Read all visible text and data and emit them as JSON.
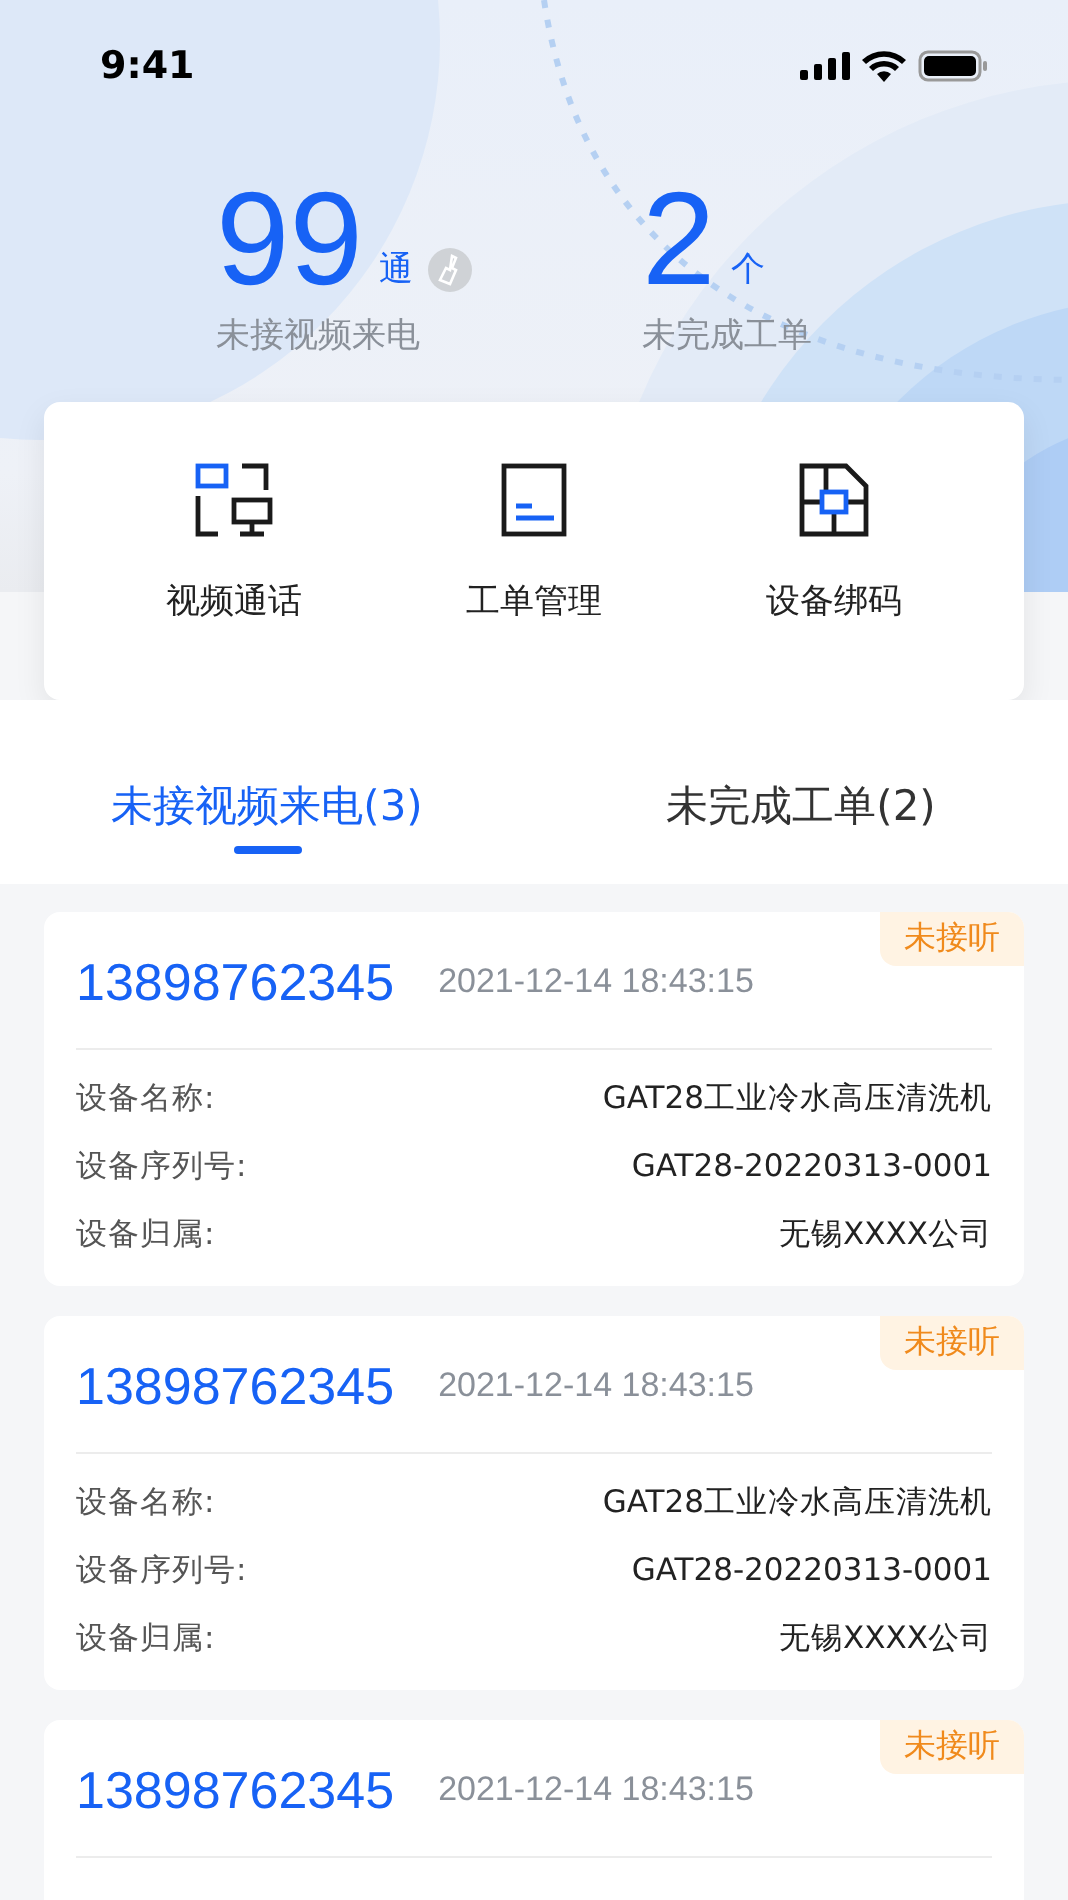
{
  "status_bar": {
    "time": "9:41"
  },
  "stats": [
    {
      "value": "99",
      "unit": "通",
      "label": "未接视频来电",
      "kind": "clearable"
    },
    {
      "value": "2",
      "unit": "个",
      "label": "未完成工单",
      "kind": "plain"
    }
  ],
  "shortcuts": [
    {
      "label": "视频通话",
      "kind": "video"
    },
    {
      "label": "工单管理",
      "kind": "order"
    },
    {
      "label": "设备绑码",
      "kind": "bind"
    }
  ],
  "tabs": [
    {
      "label": "未接视频来电(3)",
      "selected": true
    },
    {
      "label": "未完成工单(2)",
      "selected": false
    }
  ],
  "calls": [
    {
      "phone": "13898762345",
      "time": "2021-12-14 18:43:15",
      "status": "未接听",
      "fields": [
        {
          "label": "设备名称:",
          "value": "GAT28工业冷水高压清洗机"
        },
        {
          "label": "设备序列号:",
          "value": "GAT28-20220313-0001"
        },
        {
          "label": "设备归属:",
          "value": "无锡XXXX公司"
        }
      ]
    },
    {
      "phone": "13898762345",
      "time": "2021-12-14 18:43:15",
      "status": "未接听",
      "fields": [
        {
          "label": "设备名称:",
          "value": "GAT28工业冷水高压清洗机"
        },
        {
          "label": "设备序列号:",
          "value": "GAT28-20220313-0001"
        },
        {
          "label": "设备归属:",
          "value": "无锡XXXX公司"
        }
      ]
    },
    {
      "phone": "13898762345",
      "time": "2021-12-14 18:43:15",
      "status": "未接听"
    }
  ]
}
